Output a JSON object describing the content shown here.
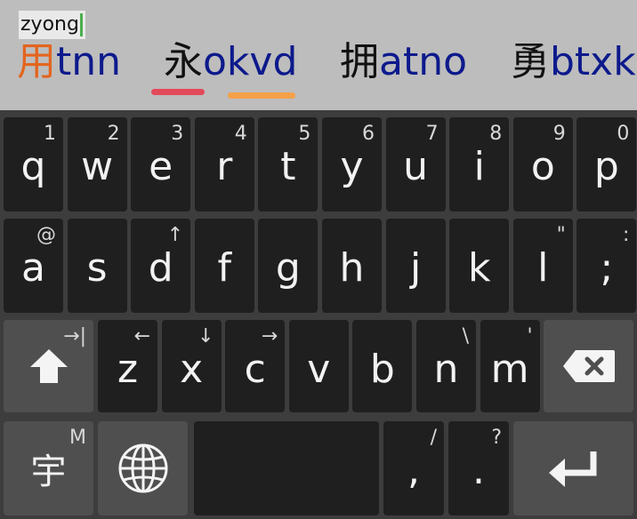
{
  "composing": "zyong",
  "candidates": [
    {
      "han": "用",
      "code": "tnn",
      "han_color": "#e3651e"
    },
    {
      "han": "永",
      "code": "okvd",
      "han_color": "#111111"
    },
    {
      "han": "拥",
      "code": "atno",
      "han_color": "#111111"
    },
    {
      "han": "勇",
      "code": "btxk",
      "han_color": "#111111"
    }
  ],
  "annotations": {
    "red": "#e24a5a",
    "orange": "#f5a04a"
  },
  "rows": {
    "row1": [
      {
        "label": "q",
        "hint": "1"
      },
      {
        "label": "w",
        "hint": "2"
      },
      {
        "label": "e",
        "hint": "3"
      },
      {
        "label": "r",
        "hint": "4"
      },
      {
        "label": "t",
        "hint": "5"
      },
      {
        "label": "y",
        "hint": "6"
      },
      {
        "label": "u",
        "hint": "7"
      },
      {
        "label": "i",
        "hint": "8"
      },
      {
        "label": "o",
        "hint": "9"
      },
      {
        "label": "p",
        "hint": "0"
      }
    ],
    "row2": [
      {
        "label": "a",
        "hint": "@"
      },
      {
        "label": "s",
        "hint": ""
      },
      {
        "label": "d",
        "hint": "↑"
      },
      {
        "label": "f",
        "hint": ""
      },
      {
        "label": "g",
        "hint": ""
      },
      {
        "label": "h",
        "hint": ""
      },
      {
        "label": "j",
        "hint": ""
      },
      {
        "label": "k",
        "hint": ""
      },
      {
        "label": "l",
        "hint": "\""
      },
      {
        "label": ";",
        "hint": ":"
      }
    ],
    "row3": [
      {
        "label": "z",
        "hint": "←"
      },
      {
        "label": "x",
        "hint": "↓"
      },
      {
        "label": "c",
        "hint": "→"
      },
      {
        "label": "v",
        "hint": ""
      },
      {
        "label": "b",
        "hint": ""
      },
      {
        "label": "n",
        "hint": "\\"
      },
      {
        "label": "m",
        "hint": "'"
      }
    ]
  },
  "shift_hint": "→|",
  "lang_key": {
    "label": "宇",
    "hint": "M"
  },
  "comma_key": {
    "label": ",",
    "hint": "/"
  },
  "period_key": {
    "label": ".",
    "hint": "?"
  },
  "icons": {
    "shift": "shift-icon",
    "globe": "globe-icon",
    "backspace": "backspace-icon",
    "enter": "enter-icon"
  }
}
